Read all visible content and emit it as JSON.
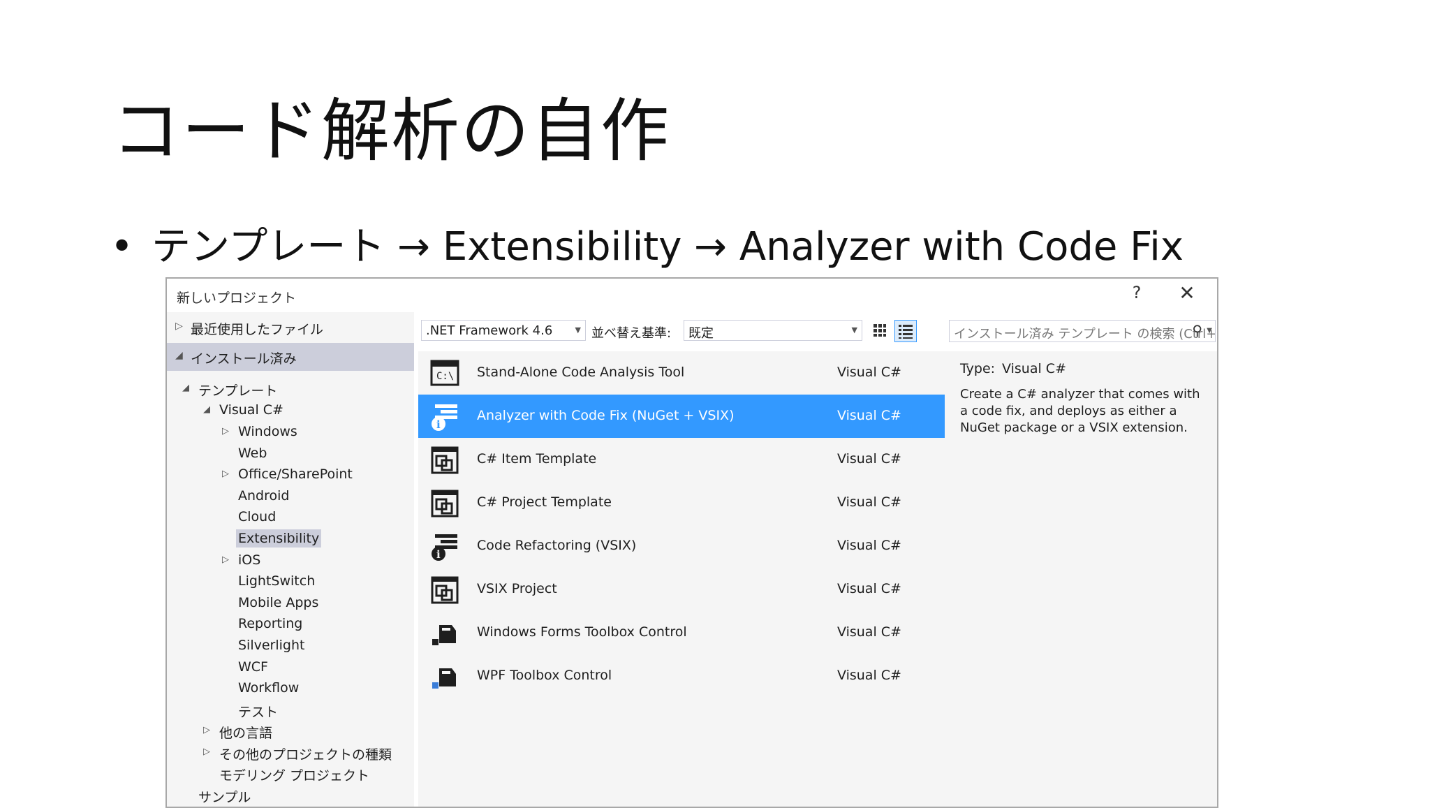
{
  "slide": {
    "title": "コード解析の自作",
    "bullet": "テンプレート → Extensibility → Analyzer with Code Fix"
  },
  "dialog": {
    "title": "新しいプロジェクト",
    "help": "?",
    "close": "✕",
    "nav": {
      "recent": "最近使用したファイル",
      "installed": "インストール済み"
    },
    "tree": {
      "templates": "テンプレート",
      "visual_csharp": "Visual C#",
      "items": [
        "Windows",
        "Web",
        "Office/SharePoint",
        "Android",
        "Cloud",
        "Extensibility",
        "iOS",
        "LightSwitch",
        "Mobile Apps",
        "Reporting",
        "Silverlight",
        "WCF",
        "Workflow",
        "テスト"
      ],
      "other_languages": "他の言語",
      "other_projects": "その他のプロジェクトの種類",
      "modeling": "モデリング プロジェクト",
      "samples": "サンプル"
    },
    "toolbar": {
      "framework": ".NET Framework 4.6",
      "sort_label": "並べ替え基準:",
      "sort_value": "既定",
      "search_placeholder": "インストール済み テンプレート の検索 (Ctrl+E"
    },
    "templates": [
      {
        "name": "Stand-Alone Code Analysis Tool",
        "lang": "Visual C#",
        "icon": "console-icon"
      },
      {
        "name": "Analyzer with Code Fix (NuGet + VSIX)",
        "lang": "Visual C#",
        "icon": "analyzer-icon"
      },
      {
        "name": "C# Item Template",
        "lang": "Visual C#",
        "icon": "template-icon"
      },
      {
        "name": "C# Project Template",
        "lang": "Visual C#",
        "icon": "template-icon"
      },
      {
        "name": "Code Refactoring (VSIX)",
        "lang": "Visual C#",
        "icon": "refactoring-icon"
      },
      {
        "name": "VSIX Project",
        "lang": "Visual C#",
        "icon": "template-icon"
      },
      {
        "name": "Windows Forms Toolbox Control",
        "lang": "Visual C#",
        "icon": "toolbox-icon"
      },
      {
        "name": "WPF Toolbox Control",
        "lang": "Visual C#",
        "icon": "wpf-toolbox-icon"
      }
    ],
    "detail": {
      "type_label": "Type:",
      "type_value": "Visual C#",
      "description": "Create a C# analyzer that comes with a code fix, and deploys as either a NuGet package or a VSIX extension."
    },
    "colors": {
      "selection": "#3399ff",
      "panel": "#f5f5f5",
      "nav_selected": "#cccedb"
    }
  }
}
